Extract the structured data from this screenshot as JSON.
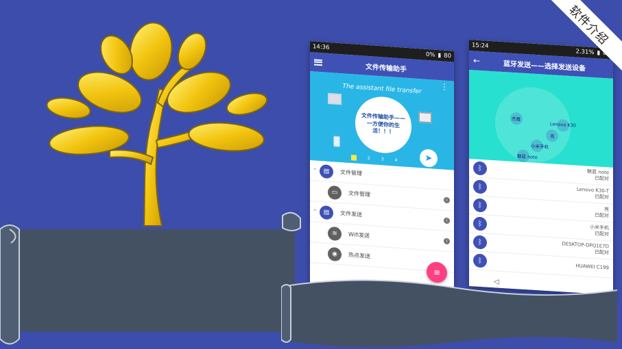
{
  "corner_banner": "软件介绍",
  "colors": {
    "background": "#3d4dab",
    "appbar": "#3f51b5",
    "hero": "#29b6e6",
    "radar": "#28e0d0",
    "fab": "#ff4081",
    "scroll": "#435163"
  },
  "phone_a": {
    "status": {
      "time": "14:36",
      "signal": "0%",
      "battery": "80"
    },
    "title": "文件传输助手",
    "hero": {
      "tagline": "The assistant file transfer",
      "badge": "文件传输助手——一方便你的生活！！！",
      "dots": [
        "2",
        "3",
        "4"
      ]
    },
    "rows": [
      {
        "type": "group",
        "label": "文件管理",
        "icon": "file-icon"
      },
      {
        "type": "child",
        "label": "文件管理",
        "icon": "folder-icon"
      },
      {
        "type": "group",
        "label": "文件发送",
        "icon": "file-send-icon"
      },
      {
        "type": "child",
        "label": "Wifi发送",
        "icon": "wifi-icon"
      },
      {
        "type": "child",
        "label": "热点发送",
        "icon": "hotspot-icon"
      }
    ]
  },
  "phone_b": {
    "status": {
      "time": "15:24",
      "signal": "2.31%",
      "battery": "87"
    },
    "title": "蓝牙发送——选择发送设备",
    "radar_labels": [
      "杰雅",
      "Lenovo K30",
      "亮",
      "小米手机",
      "魅蓝 note"
    ],
    "devices": [
      {
        "name": "魅蓝 note",
        "status": "已配对"
      },
      {
        "name": "Lenovo K30-T",
        "status": "已配对"
      },
      {
        "name": "亮",
        "status": "已配对"
      },
      {
        "name": "小米手机",
        "status": "已配对"
      },
      {
        "name": "DESKTOP-DPQ1E7D",
        "status": "已配对"
      },
      {
        "name": "HUAWEI C199",
        "status": ""
      }
    ]
  }
}
